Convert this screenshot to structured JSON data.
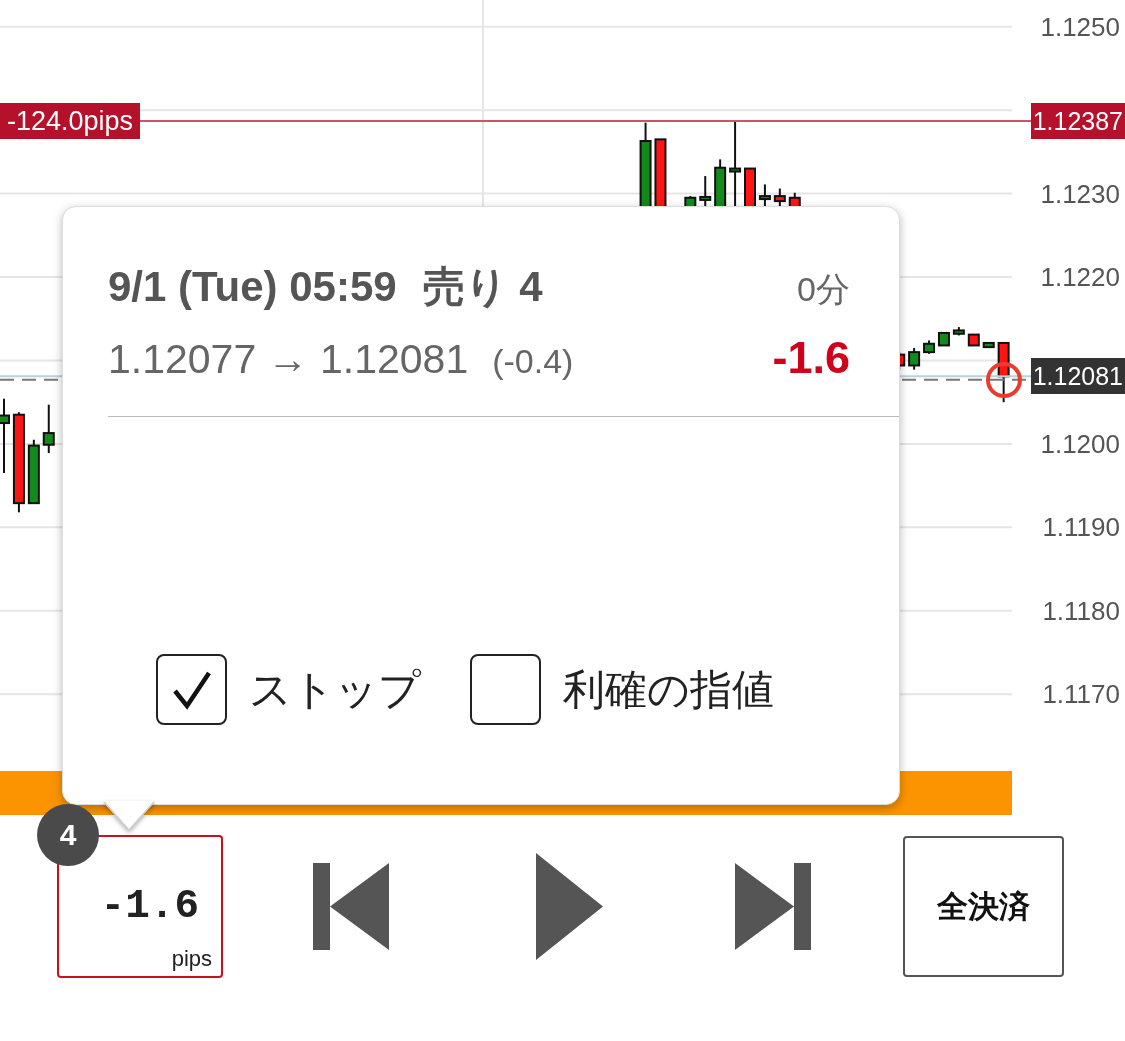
{
  "chart": {
    "chart_data": {
      "type": "candlestick",
      "categories": [
        null,
        null,
        null,
        null,
        null,
        null,
        null,
        null,
        null,
        null,
        null,
        null,
        null,
        null,
        null,
        null,
        null,
        null,
        null,
        null,
        null,
        null,
        null,
        null,
        null,
        null,
        null,
        null,
        null,
        null,
        null,
        null,
        null,
        null,
        null,
        null,
        null,
        null,
        null,
        null,
        null,
        null,
        null,
        null,
        null,
        null,
        null,
        null,
        null,
        null,
        null,
        null,
        null,
        null,
        null,
        null,
        null,
        null,
        null,
        null,
        null,
        null,
        null,
        null,
        null,
        null,
        null,
        null
      ],
      "ohlc": [
        [
          1.12025,
          1.12054,
          1.11965,
          1.12034
        ],
        [
          1.12035,
          1.12038,
          1.11918,
          1.11929
        ],
        [
          1.11929,
          1.12005,
          1.11929,
          1.11998
        ],
        [
          1.11999,
          1.12047,
          1.11989,
          1.12013
        ],
        null,
        null,
        null,
        null,
        null,
        null,
        null,
        null,
        null,
        null,
        null,
        null,
        null,
        null,
        null,
        null,
        null,
        null,
        null,
        null,
        null,
        null,
        null,
        null,
        null,
        null,
        null,
        null,
        null,
        null,
        null,
        null,
        null,
        null,
        null,
        null,
        null,
        null,
        null,
        [
          1.12283,
          1.12385,
          1.12283,
          1.12363
        ],
        [
          1.12365,
          1.12365,
          1.12283,
          1.12283
        ],
        null,
        [
          1.12283,
          1.12297,
          1.12283,
          1.12295
        ],
        [
          1.12293,
          1.12321,
          1.12283,
          1.12296
        ],
        [
          1.12283,
          1.12341,
          1.12283,
          1.12331
        ],
        [
          1.12327,
          1.12387,
          1.12283,
          1.1233
        ],
        [
          1.1233,
          1.1233,
          1.12283,
          1.12283
        ],
        [
          1.12294,
          1.12311,
          1.12283,
          1.12297
        ],
        [
          1.12297,
          1.12306,
          1.12283,
          1.12291
        ],
        [
          1.12295,
          1.12301,
          1.12283,
          1.12283
        ],
        null,
        null,
        null,
        null,
        null,
        null,
        [
          1.12107,
          1.1211,
          1.12089,
          1.12094
        ],
        [
          1.12094,
          1.12115,
          1.12089,
          1.1211
        ],
        [
          1.1211,
          1.12124,
          1.12108,
          1.1212
        ],
        [
          1.12118,
          1.12133,
          1.12118,
          1.12133
        ],
        [
          1.12132,
          1.1214,
          1.1213,
          1.12136
        ],
        [
          1.12131,
          1.12131,
          1.12118,
          1.12118
        ],
        [
          1.12116,
          1.12121,
          1.12116,
          1.12121
        ],
        [
          1.12121,
          1.12121,
          1.1205,
          1.12081
        ]
      ],
      "ylim": [
        1.11608,
        1.12532
      ],
      "yticks": [
        {
          "value": 1.125,
          "label": "1.1250"
        },
        {
          "value": 1.123,
          "label": "1.1230"
        },
        {
          "value": 1.122,
          "label": "1.1220"
        },
        {
          "value": 1.12,
          "label": "1.1200"
        },
        {
          "value": 1.119,
          "label": "1.1190"
        },
        {
          "value": 1.118,
          "label": "1.1180"
        },
        {
          "value": 1.117,
          "label": "1.1170"
        }
      ],
      "grid": true,
      "ref_lines": [
        {
          "axis": "y",
          "value": 1.12387,
          "color": "#c9566a"
        },
        {
          "axis": "y",
          "value": 1.12081,
          "color": "#b9d3d6"
        },
        {
          "axis": "y",
          "value": 1.12077,
          "color": "#777777"
        }
      ]
    },
    "stop_line": {
      "pips": "-124.0pips",
      "price": "1.12387"
    },
    "current_price": "1.12081"
  },
  "popup": {
    "datetime": "9/1 (Tue) 05:59",
    "side": "売り 4",
    "duration": "0分",
    "prices": "1.12077 → 1.12081",
    "spread": "(-0.4)",
    "profit": "-1.6",
    "checkboxes": [
      {
        "label": "ストップ",
        "checked": true
      },
      {
        "label": "利確の指値",
        "checked": false
      }
    ]
  },
  "controls": {
    "position_count": "4",
    "profit": "-1.6",
    "unit": "pips",
    "close_all": "全決済"
  }
}
